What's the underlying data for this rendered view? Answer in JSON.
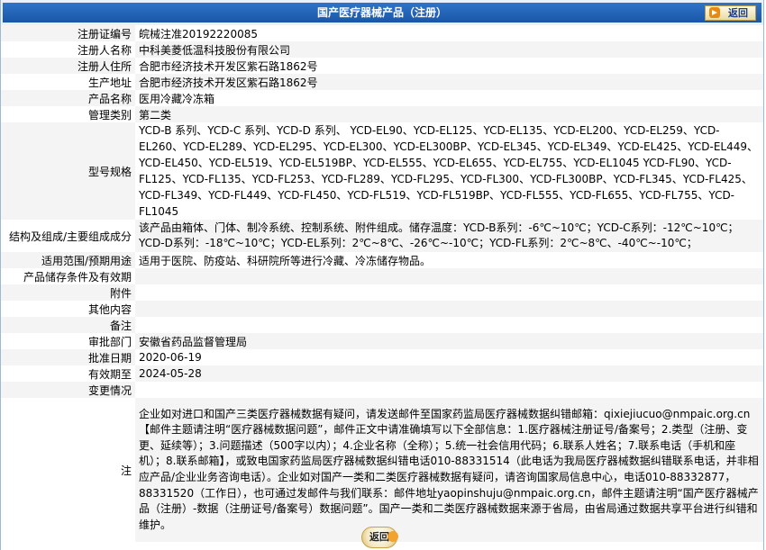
{
  "header": {
    "title": "国产医疗器械产品（注册）",
    "back_label": "返回"
  },
  "rows": [
    {
      "label": "注册证编号",
      "value": "皖械注准20192220085"
    },
    {
      "label": "注册人名称",
      "value": "中科美菱低温科技股份有限公司"
    },
    {
      "label": "注册人住所",
      "value": "合肥市经济技术开发区紫石路1862号"
    },
    {
      "label": "生产地址",
      "value": "合肥市经济技术开发区紫石路1862号"
    },
    {
      "label": "产品名称",
      "value": "医用冷藏冷冻箱"
    },
    {
      "label": "管理类别",
      "value": "第二类"
    },
    {
      "label": "型号规格",
      "value": "YCD-B 系列、YCD-C 系列、YCD-D 系列、 YCD-EL90、YCD-EL125、YCD-EL135、YCD-EL200、YCD-EL259、YCD-EL260、YCD-EL289、YCD-EL295、YCD-EL300、YCD-EL300BP、YCD-EL345、YCD-EL349、YCD-EL425、YCD-EL449、YCD-EL450、YCD-EL519、YCD-EL519BP、YCD-EL555、YCD-EL655、YCD-EL755、YCD-EL1045 YCD-FL90、YCD-FL125、YCD-FL135、YCD-FL253、YCD-FL289、YCD-FL295、YCD-FL300、YCD-FL300BP、YCD-FL345、YCD-FL425、YCD-FL349、YCD-FL449、YCD-FL450、YCD-FL519、YCD-FL519BP、YCD-FL555、YCD-FL655、YCD-FL755、YCD-FL1045"
    },
    {
      "label": "结构及组成/主要组成成分",
      "value": "该产品由箱体、门体、制冷系统、控制系统、附件组成。储存温度：YCD-B系列：-6℃~10℃；YCD-C系列：-12℃~10℃；YCD-D系列：-18℃~10℃；YCD-EL系列：2℃~8℃、-26℃~-10℃；YCD-FL系列：2℃~8℃、-40℃~-10℃；"
    },
    {
      "label": "适用范围/预期用途",
      "value": "适用于医院、防疫站、科研院所等进行冷藏、冷冻储存物品。"
    },
    {
      "label": "产品储存条件及有效期",
      "value": ""
    },
    {
      "label": "附件",
      "value": ""
    },
    {
      "label": "其他内容",
      "value": ""
    },
    {
      "label": "备注",
      "value": ""
    },
    {
      "label": "审批部门",
      "value": "安徽省药品监督管理局"
    },
    {
      "label": "批准日期",
      "value": "2020-06-19"
    },
    {
      "label": "有效期至",
      "value": "2024-05-28"
    },
    {
      "label": "变更情况",
      "value": ""
    },
    {
      "label": "注",
      "value": "企业如对进口和国产三类医疗器械数据有疑问，请发送邮件至国家药监局医疗器械数据纠错邮箱：qixiejiucuo@nmpaic.org.cn【邮件主题请注明“医疗器械数据问题”，邮件正文中请准确填写以下全部信息：1.医疗器械注册证号/备案号；2.类型（注册、变更、延续等）；3.问题描述（500字以内）；4.企业名称（全称）；5.统一社会信用代码；6.联系人姓名；7.联系电话（手机和座机）；8.联系邮箱】，或致电国家药监局医疗器械数据纠错电话010-88331514（此电话为我局医疗器械数据纠错联系电话，并非相应产品/企业业务咨询电话）。企业如对国产一类和二类医疗器械数据有疑问，请咨询国家局信息中心，电话010-88332877，88331520（工作日），也可通过发邮件与我们联系：邮件地址yaopinshuju@nmpaic.org.cn，邮件主题请注明“国产医疗器械产品（注册）-数据（注册证号/备案号）数据问题”。国产一类和二类医疗器械数据来源于省局，由省局通过数据共享平台进行纠错和维护。"
    }
  ]
}
